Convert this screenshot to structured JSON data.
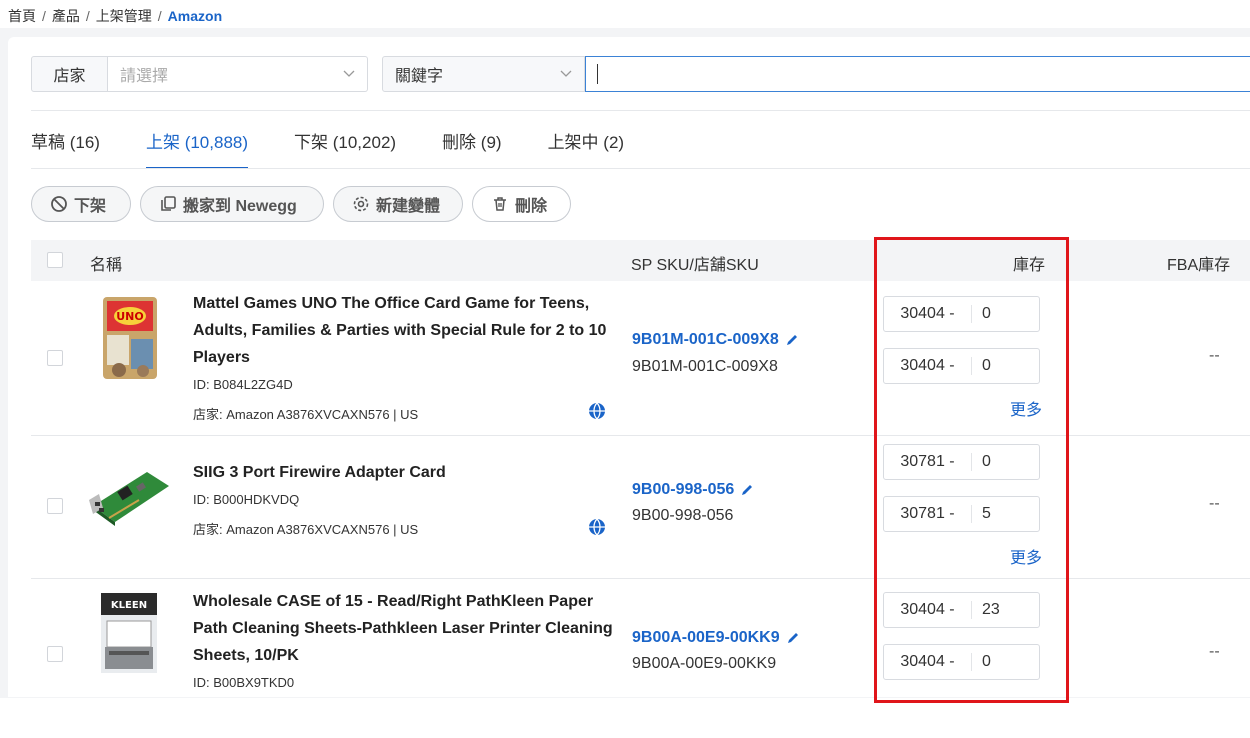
{
  "breadcrumb": [
    "首頁",
    "產品",
    "上架管理",
    "Amazon"
  ],
  "filters": {
    "store_label": "店家",
    "store_placeholder": "請選擇",
    "keyword_label": "關鍵字",
    "keyword_value": ""
  },
  "tabs": [
    {
      "label": "草稿 (16)",
      "active": false
    },
    {
      "label": "上架 (10,888)",
      "active": true
    },
    {
      "label": "下架 (10,202)",
      "active": false
    },
    {
      "label": "刪除 (9)",
      "active": false
    },
    {
      "label": "上架中 (2)",
      "active": false
    }
  ],
  "actions": {
    "delist": "下架",
    "move_newegg": "搬家到 Newegg",
    "new_variant": "新建變體",
    "delete": "刪除"
  },
  "table": {
    "headers": {
      "name": "名稱",
      "sku": "SP SKU/店舖SKU",
      "stock": "庫存",
      "fba": "FBA庫存"
    },
    "rows": [
      {
        "title": "Mattel Games UNO The Office Card Game for Teens, Adults, Families & Parties with Special Rule for 2 to 10 Players",
        "id": "ID: B084L2ZG4D",
        "store": "店家: Amazon A3876XVCAXN576 | US",
        "sp_sku": "9B01M-001C-009X8",
        "store_sku": "9B01M-001C-009X8",
        "stock": [
          {
            "warehouse": "30404 -",
            "qty": "0"
          },
          {
            "warehouse": "30404 -",
            "qty": "0"
          }
        ],
        "more": "更多",
        "fba": "--"
      },
      {
        "title": "SIIG 3 Port Firewire Adapter Card",
        "id": "ID: B000HDKVDQ",
        "store": "店家: Amazon A3876XVCAXN576 | US",
        "sp_sku": "9B00-998-056",
        "store_sku": "9B00-998-056",
        "stock": [
          {
            "warehouse": "30781 -",
            "qty": "0"
          },
          {
            "warehouse": "30781 -",
            "qty": "5"
          }
        ],
        "more": "更多",
        "fba": "--"
      },
      {
        "title": "Wholesale CASE of 15 - Read/Right PathKleen Paper Path Cleaning Sheets-Pathkleen Laser Printer Cleaning Sheets, 10/PK",
        "id": "ID: B00BX9TKD0",
        "sp_sku": "9B00A-00E9-00KK9",
        "store_sku": "9B00A-00E9-00KK9",
        "stock": [
          {
            "warehouse": "30404 -",
            "qty": "23"
          },
          {
            "warehouse": "30404 -",
            "qty": "0"
          }
        ],
        "fba": "--"
      }
    ]
  },
  "colors": {
    "accent": "#1a64c8",
    "highlight": "#e0151a"
  }
}
